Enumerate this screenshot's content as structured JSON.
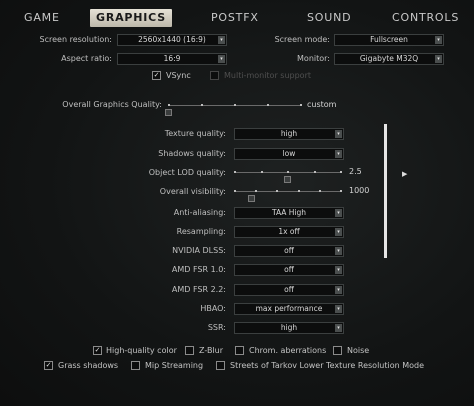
{
  "tabs": [
    {
      "label": "GAME",
      "active": false
    },
    {
      "label": "GRAPHICS",
      "active": true
    },
    {
      "label": "POSTFX",
      "active": false
    },
    {
      "label": "SOUND",
      "active": false
    },
    {
      "label": "CONTROLS",
      "active": false
    }
  ],
  "top_settings": {
    "screen_resolution": {
      "label": "Screen resolution:",
      "value": "2560x1440 (16:9)"
    },
    "screen_mode": {
      "label": "Screen mode:",
      "value": "Fullscreen"
    },
    "aspect_ratio": {
      "label": "Aspect ratio:",
      "value": "16:9"
    },
    "monitor": {
      "label": "Monitor:",
      "value": "Gigabyte M32Q"
    },
    "vsync": {
      "label": "VSync",
      "checked": true
    },
    "multi_monitor": {
      "label": "Multi-monitor support",
      "checked": false,
      "disabled": true
    }
  },
  "overall_quality": {
    "label": "Overall Graphics Quality:",
    "value": "custom"
  },
  "settings": [
    {
      "label": "Texture quality:",
      "type": "dropdown",
      "value": "high"
    },
    {
      "label": "Shadows quality:",
      "type": "dropdown",
      "value": "low"
    },
    {
      "label": "Object LOD quality:",
      "type": "slider",
      "value": "2.5",
      "level": 0.5
    },
    {
      "label": "Overall visibility:",
      "type": "slider",
      "value": "1000",
      "level": 0.167
    },
    {
      "label": "Anti-aliasing:",
      "type": "dropdown",
      "value": "TAA High"
    },
    {
      "label": "Resampling:",
      "type": "dropdown",
      "value": "1x off"
    },
    {
      "label": "NVIDIA DLSS:",
      "type": "dropdown",
      "value": "off"
    },
    {
      "label": "AMD FSR 1.0:",
      "type": "dropdown",
      "value": "off"
    },
    {
      "label": "AMD FSR 2.2:",
      "type": "dropdown",
      "value": "off"
    },
    {
      "label": "HBAO:",
      "type": "dropdown",
      "value": "max performance"
    },
    {
      "label": "SSR:",
      "type": "dropdown",
      "value": "high"
    }
  ],
  "bottom_checks_row1": [
    {
      "label": "High-quality color",
      "checked": true
    },
    {
      "label": "Z-Blur",
      "checked": false
    },
    {
      "label": "Chrom. aberrations",
      "checked": false
    },
    {
      "label": "Noise",
      "checked": false
    }
  ],
  "bottom_checks_row2": [
    {
      "label": "Grass shadows",
      "checked": true
    },
    {
      "label": "Mip Streaming",
      "checked": false
    },
    {
      "label": "Streets of Tarkov Lower Texture Resolution Mode",
      "checked": false
    }
  ],
  "icons": {
    "dropdown_arrow": "▾",
    "check": "✓",
    "slider_knob": "▾",
    "cursor": "▶"
  },
  "colors": {
    "active_tab_bg": "#d8d4c8",
    "background": "#121414",
    "scrollbar": "#e6e6e6"
  }
}
